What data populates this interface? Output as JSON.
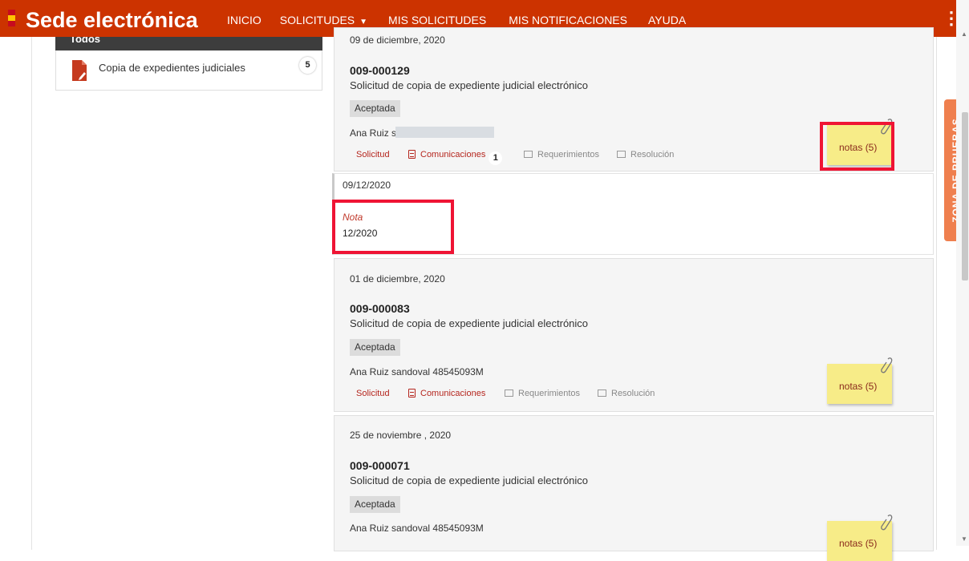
{
  "header": {
    "brand": "Sede electrónica",
    "nav": [
      "INICIO",
      "SOLICITUDES",
      "MIS SOLICITUDES",
      "MIS NOTIFICACIONES",
      "AYUDA"
    ],
    "solicitudes_caret": "▼",
    "menu_icon": "⋮",
    "flag_colors": [
      "#c60b1e",
      "#ffc400",
      "#c60b1e"
    ]
  },
  "sidebar": {
    "header_label": "Todos",
    "item": {
      "label": "Copia de expedientes judiciales",
      "count": "5"
    }
  },
  "cards": [
    {
      "date": "09 de diciembre, 2020",
      "code": "009-000129",
      "description": "Solicitud de copia de expediente judicial electrónico",
      "status": "Aceptada",
      "applicant": "Ana Ruiz s",
      "links": {
        "solicitud": "Solicitud",
        "comunicaciones": "Comunicaciones",
        "comunicaciones_count": "1",
        "requerimientos": "Requerimientos",
        "resolucion": "Resolución"
      },
      "notes": "notas (5)"
    },
    {
      "date": "01 de diciembre, 2020",
      "code": "009-000083",
      "description": "Solicitud de copia de expediente judicial electrónico",
      "status": "Aceptada",
      "applicant": "Ana Ruiz sandoval 48545093M",
      "links": {
        "solicitud": "Solicitud",
        "comunicaciones": "Comunicaciones",
        "requerimientos": "Requerimientos",
        "resolucion": "Resolución"
      },
      "notes": "notas (5)"
    },
    {
      "date": "25 de noviembre , 2020",
      "code": "009-000071",
      "description": "Solicitud de copia de expediente judicial electrónico",
      "status": "Aceptada",
      "applicant": "Ana Ruiz sandoval 48545093M",
      "notes": "notas (5)"
    }
  ],
  "nota_panel": {
    "date": "09/12/2020",
    "title": "Nota",
    "text": "12/2020"
  },
  "zona_pruebas": "ZONA DE PRUEBAS",
  "colors": {
    "header_bg": "#cc3300",
    "accent_red": "#b5261e",
    "highlight": "#ef1434",
    "note_yellow": "#f7ec88",
    "zona": "#ef7f4e"
  }
}
